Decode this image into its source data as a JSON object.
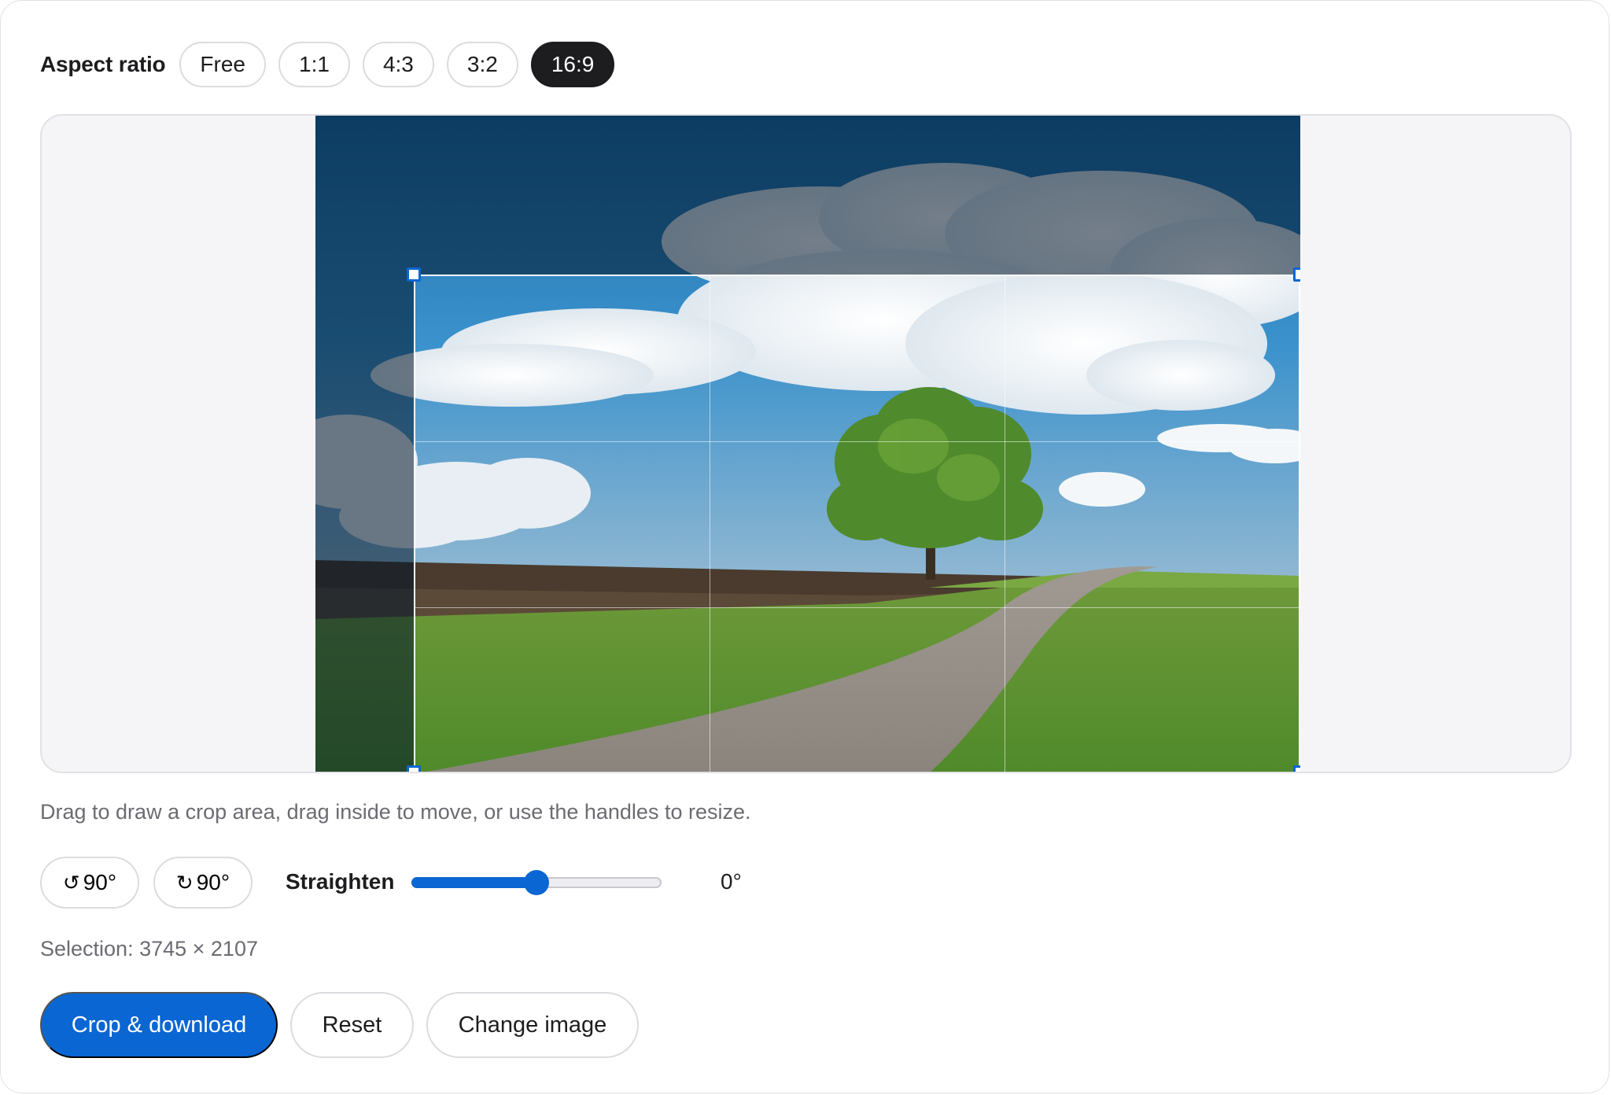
{
  "aspect_ratio": {
    "label": "Aspect ratio",
    "options": [
      "Free",
      "1:1",
      "4:3",
      "3:2",
      "16:9"
    ],
    "selected": "16:9"
  },
  "hint": "Drag to draw a crop area, drag inside to move, or use the handles to resize.",
  "rotate": {
    "left_icon": "↺",
    "left_label": "90°",
    "right_icon": "↻",
    "right_label": "90°"
  },
  "straighten": {
    "label": "Straighten",
    "value_text": "0°",
    "fraction": 0.5
  },
  "selection": "Selection: 3745 × 2107",
  "actions": {
    "crop_download": "Crop & download",
    "reset": "Reset",
    "change_image": "Change image"
  },
  "colors": {
    "accent": "#0a66d2",
    "selected_pill": "#1d1d1f"
  }
}
